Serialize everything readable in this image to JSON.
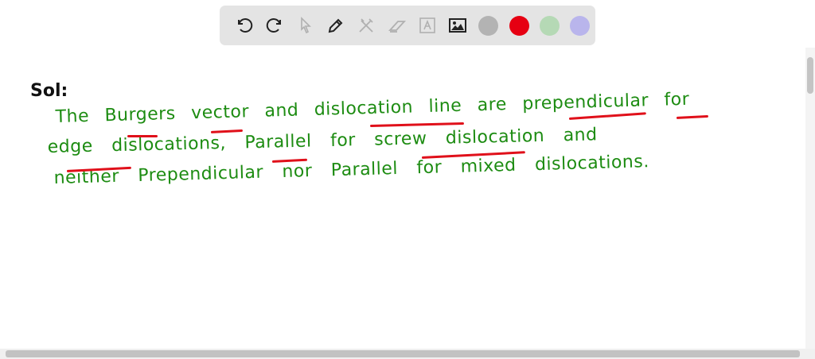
{
  "toolbar": {
    "tools": [
      "undo-icon",
      "redo-icon",
      "select-icon",
      "pen-icon",
      "tools-icon",
      "eraser-icon",
      "text-icon",
      "image-icon"
    ],
    "colors": {
      "gray": "#b3b3b3",
      "red": "#e60012",
      "green": "#b5d9b5",
      "purple": "#b9b5ec"
    }
  },
  "canvas": {
    "label": "Sol:",
    "lines": [
      "The  Burgers  vector  and  dislocation  line  are  prependicular  for",
      "edge  dislocations,  Parallel  for  screw  dislocation  and",
      "neither  Prependicular  nor  Parallel  for  mixed  dislocations."
    ],
    "ink_color": "#1d8c12",
    "underline_color": "#e0101a"
  }
}
